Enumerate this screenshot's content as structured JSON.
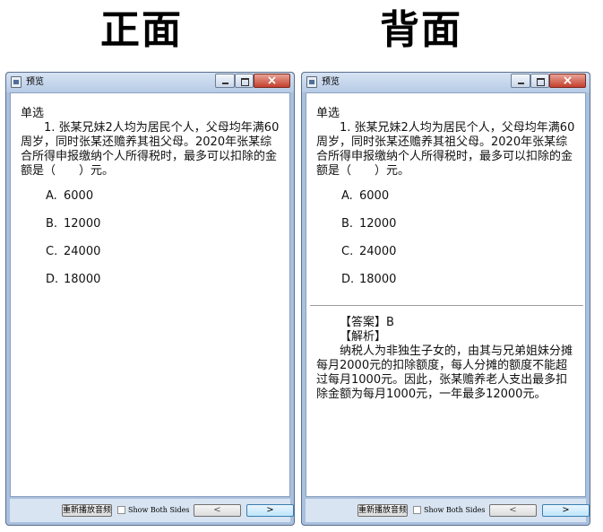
{
  "headings": {
    "front": "正面",
    "back": "背面"
  },
  "window": {
    "title": "预览",
    "replay_label": "重新播放音频",
    "show_both_sides_label": "Show Both Sides",
    "prev_label": "<",
    "next_label": ">"
  },
  "question": {
    "type": "单选",
    "text": "1. 张某兄妹2人均为居民个人，父母均年满60周岁，同时张某还赡养其祖父母。2020年张某综合所得申报缴纳个人所得税时，最多可以扣除的金额是（　　）元。",
    "options": [
      {
        "letter": "A.",
        "value": "6000"
      },
      {
        "letter": "B.",
        "value": "12000"
      },
      {
        "letter": "C.",
        "value": "24000"
      },
      {
        "letter": "D.",
        "value": "18000"
      }
    ]
  },
  "answer": {
    "answer_line": "【答案】B",
    "analysis_title": "【解析】",
    "analysis_text": "纳税人为非独生子女的，由其与兄弟姐妹分摊每月2000元的扣除额度，每人分摊的额度不能超过每月1000元。因此，张某赡养老人支出最多扣除金额为每月1000元，一年最多12000元。"
  }
}
